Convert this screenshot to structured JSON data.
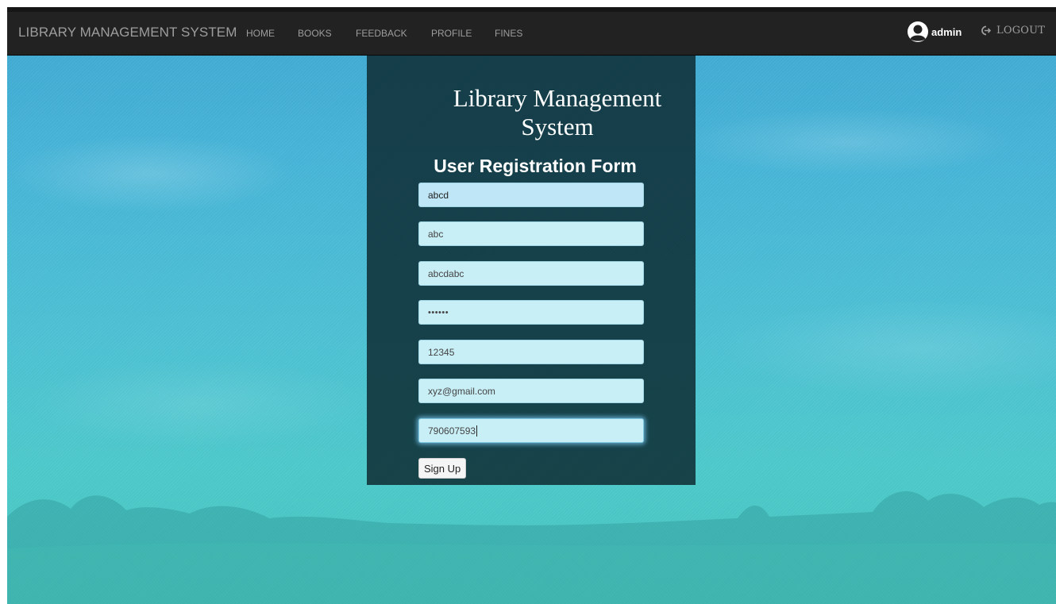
{
  "navbar": {
    "brand": "LIBRARY MANAGEMENT SYSTEM",
    "links": [
      "HOME",
      "BOOKS",
      "FEEDBACK",
      "PROFILE",
      "FINES"
    ],
    "user": {
      "icon": "user-avatar-icon",
      "name": "admin"
    },
    "logout": {
      "icon": "logout-icon",
      "label": "LOGOUT"
    }
  },
  "form": {
    "title": "Library Management System",
    "heading": "User Registration Form",
    "fields": [
      {
        "value": "abcd"
      },
      {
        "value": "abc"
      },
      {
        "value": "abcdabc"
      },
      {
        "value": "••••••"
      },
      {
        "value": "12345"
      },
      {
        "value": "xyz@gmail.com"
      },
      {
        "value": "790607593"
      }
    ],
    "submit_label": "Sign Up"
  },
  "colors": {
    "navbar_bg": "#222222",
    "nav_text": "#9d9d9d",
    "panel_bg": "#0c2830",
    "field_bg": "#c8eef6",
    "sky": "#46b3d6"
  }
}
